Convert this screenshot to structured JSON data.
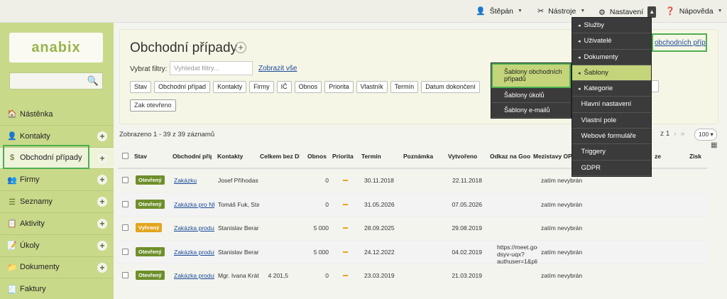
{
  "topbar": {
    "user": "Štěpán",
    "tools": "Nástroje",
    "settings": "Nastavení",
    "help": "Nápověda"
  },
  "sidebar": {
    "logo": "anabix",
    "items": [
      {
        "label": "Nástěnka",
        "icon": "home-icon",
        "plus": false
      },
      {
        "label": "Kontakty",
        "icon": "person-icon",
        "plus": true
      },
      {
        "label": "Obchodní případy",
        "icon": "dollar-icon",
        "plus": true
      },
      {
        "label": "Firmy",
        "icon": "group-icon",
        "plus": true
      },
      {
        "label": "Seznamy",
        "icon": "list-icon",
        "plus": true
      },
      {
        "label": "Aktivity",
        "icon": "clipboard-icon",
        "plus": true
      },
      {
        "label": "Úkoly",
        "icon": "task-icon",
        "plus": true
      },
      {
        "label": "Dokumenty",
        "icon": "document-icon",
        "plus": true
      },
      {
        "label": "Faktury",
        "icon": "invoice-icon",
        "plus": false
      }
    ]
  },
  "header": {
    "title": "Obchodní případy",
    "filter_label": "Vybrat filtry:",
    "filter_placeholder": "Vyhledat filtry...",
    "show_all": "Zobrazit vše",
    "chips": [
      "Stav",
      "Obchodní případ",
      "Kontakty",
      "Firmy",
      "IČ",
      "Obnos",
      "Priorita",
      "Vlastník",
      "Termín",
      "Datum dokončení"
    ],
    "open_chip": "Zak otevřeno",
    "right_link": "obchodních případů"
  },
  "results": {
    "info": "Zobrazeno 1 - 39 z 39 záznamů",
    "pager": "z 1",
    "per_page": "100"
  },
  "table": {
    "headers": [
      "Stav",
      "Obchodní příp",
      "Kontakty",
      "Celkem bez DF",
      "Obnos",
      "Priorita",
      "Termín",
      "Poznámka",
      "Vytvořeno",
      "Odkaz na Goog",
      "Mezistavy OP",
      "ze",
      "Zisk"
    ],
    "rows": [
      {
        "status": "Otevřený",
        "type": "open",
        "name": "Zakázku",
        "contact": "Josef Příhodas",
        "total": "",
        "amount": "0",
        "deadline": "30.11.2018",
        "created": "22.11.2018",
        "link": "",
        "stage": "zatím nevybrán"
      },
      {
        "status": "Otevřený",
        "type": "open",
        "name": "Zakázka pro NĚ",
        "contact": "Tomáš Fuk, Sta",
        "total": "",
        "amount": "0",
        "deadline": "31.05.2026",
        "created": "07.05.2026",
        "link": "",
        "stage": "zatím nevybrán"
      },
      {
        "status": "Vyhraný",
        "type": "won",
        "name": "Zakázka produl",
        "contact": "Stanislav Berar",
        "total": "",
        "amount": "5 000",
        "deadline": "28.09.2025",
        "created": "29.08.2019",
        "link": "",
        "stage": "zatím nevybrán"
      },
      {
        "status": "Otevřený",
        "type": "open",
        "name": "Zakázka produl",
        "contact": "Stanislav Berar",
        "total": "",
        "amount": "5 000",
        "deadline": "24.12.2022",
        "created": "04.02.2019",
        "link": "https://meet.goo dsyv-uqx? authuser=1&pli",
        "stage": "zatím nevybrán"
      },
      {
        "status": "Otevřený",
        "type": "open",
        "name": "Zakázka produl",
        "contact": "Mgr. Ivana Krát",
        "total": "4 201,5",
        "amount": "0",
        "deadline": "23.03.2019",
        "created": "21.03.2019",
        "link": "",
        "stage": "zatím nevybrán"
      }
    ]
  },
  "settings_menu": [
    {
      "label": "Služby"
    },
    {
      "label": "Uživatelé"
    },
    {
      "label": "Dokumenty"
    },
    {
      "label": "Šablony",
      "selected": true
    },
    {
      "label": "Kategorie"
    },
    {
      "label": "Hlavní nastavení",
      "noarrow": true
    },
    {
      "label": "Vlastní pole",
      "noarrow": true
    },
    {
      "label": "Webové formuláře",
      "noarrow": true
    },
    {
      "label": "Triggery",
      "noarrow": true
    },
    {
      "label": "GDPR",
      "noarrow": true
    }
  ],
  "templates_submenu": [
    "Šablony obchodních případů",
    "Šablony úkolů",
    "Šablony e-mailů"
  ]
}
